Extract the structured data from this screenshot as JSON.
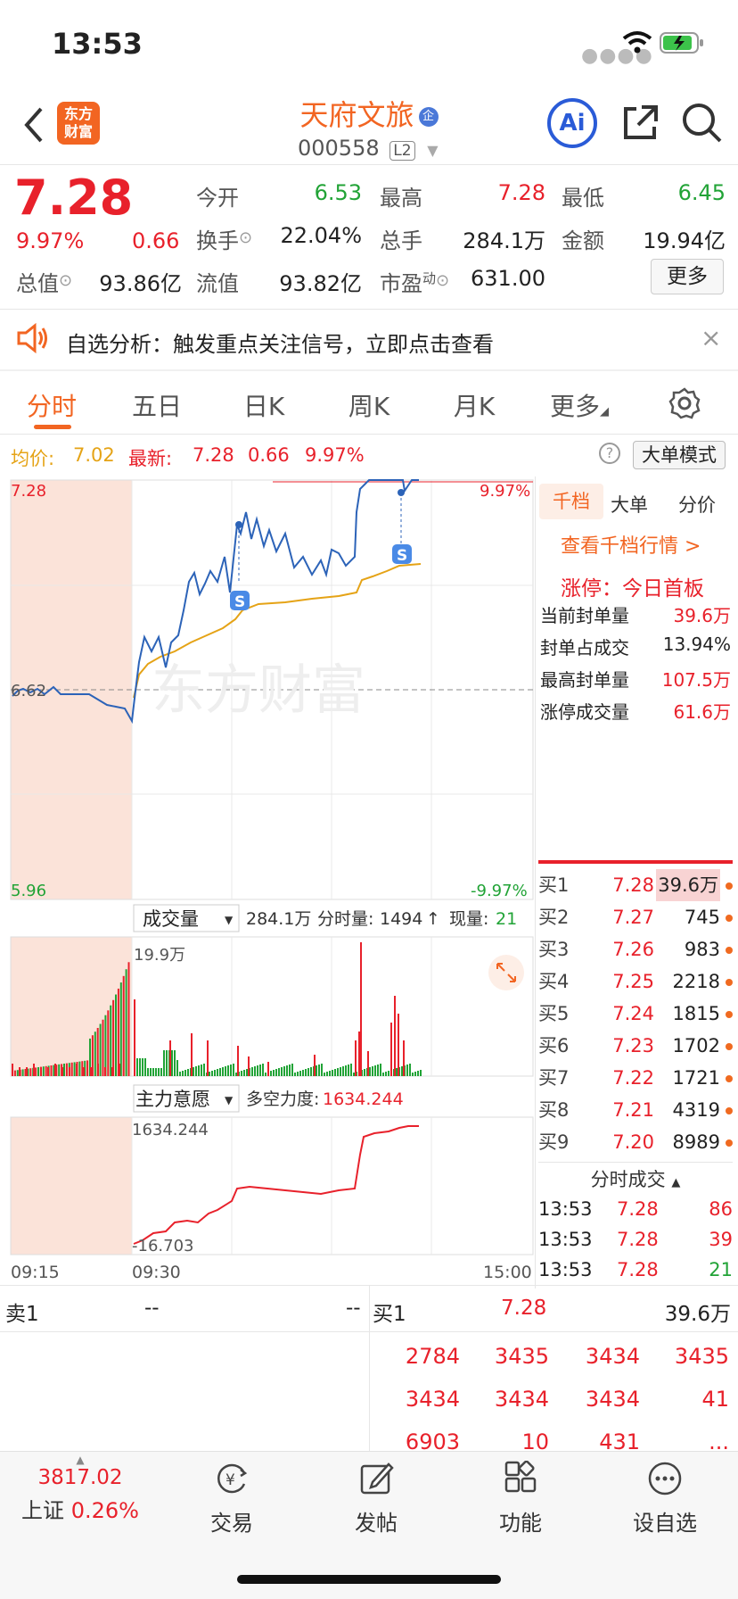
{
  "status": {
    "time": "13:53"
  },
  "header": {
    "logo_line1": "东方",
    "logo_line2": "财富",
    "title": "天府文旅",
    "badge": "企",
    "code": "000558",
    "level": "L2",
    "ai": "Ai"
  },
  "quote": {
    "price": "7.28",
    "pct": "9.97%",
    "change": "0.66",
    "open_l": "今开",
    "open_v": "6.53",
    "high_l": "最高",
    "high_v": "7.28",
    "low_l": "最低",
    "low_v": "6.45",
    "turn_l": "换手",
    "turn_v": "22.04%",
    "vol_l": "总手",
    "vol_v": "284.1万",
    "amt_l": "金额",
    "amt_v": "19.94亿",
    "mcap_l": "总值",
    "mcap_v": "93.86亿",
    "float_l": "流值",
    "float_v": "93.82亿",
    "pe_l": "市盈",
    "pe_sup": "动",
    "pe_v": "631.00",
    "more": "更多"
  },
  "banner": {
    "text": "自选分析：触发重点关注信号，立即点击查看"
  },
  "tabs": [
    "分时",
    "五日",
    "日K",
    "周K",
    "月K",
    "更多"
  ],
  "info": {
    "avg_l": "均价:",
    "avg_v": "7.02",
    "last_l": "最新:",
    "last_v": "7.28",
    "chg": "0.66",
    "pct": "9.97%",
    "mode": "大单模式"
  },
  "chart": {
    "y_top": "7.28",
    "y_mid": "6.62",
    "y_bot": "5.96",
    "pct_top": "9.97%",
    "pct_bot": "-9.97%",
    "vol_btn": "成交量",
    "vol_total": "284.1万",
    "vol_fen_l": "分时量:",
    "vol_fen_v": "1494",
    "vol_now_l": "现量:",
    "vol_now_v": "21",
    "vol_max": "19.9万",
    "ind_btn": "主力意愿",
    "ind_l": "多空力度:",
    "ind_v": "1634.244",
    "ind_top": "1634.244",
    "ind_bot": "-16.703",
    "t0": "09:15",
    "t1": "09:30",
    "t2": "15:00",
    "watermark": "东方财富",
    "s_mark": "S"
  },
  "chart_data": {
    "type": "line",
    "x": [
      "09:15",
      "09:30",
      "15:00"
    ],
    "ylim": [
      5.96,
      7.28
    ],
    "series": [
      {
        "name": "均价",
        "color": "#e5a316"
      },
      {
        "name": "最新",
        "color": "#2c63b8"
      }
    ]
  },
  "side": {
    "t1": "千档",
    "t2": "大单",
    "t3": "分价",
    "link": "查看千档行情 >",
    "limit": "涨停：今日首板",
    "r1_l": "当前封单量",
    "r1_v": "39.6万",
    "r2_l": "封单占成交",
    "r2_v": "13.94%",
    "r3_l": "最高封单量",
    "r3_v": "107.5万",
    "r4_l": "涨停成交量",
    "r4_v": "61.6万"
  },
  "book": [
    {
      "n": "买1",
      "p": "7.28",
      "v": "39.6万"
    },
    {
      "n": "买2",
      "p": "7.27",
      "v": "745"
    },
    {
      "n": "买3",
      "p": "7.26",
      "v": "983"
    },
    {
      "n": "买4",
      "p": "7.25",
      "v": "2218"
    },
    {
      "n": "买5",
      "p": "7.24",
      "v": "1815"
    },
    {
      "n": "买6",
      "p": "7.23",
      "v": "1702"
    },
    {
      "n": "买7",
      "p": "7.22",
      "v": "1721"
    },
    {
      "n": "买8",
      "p": "7.21",
      "v": "4319"
    },
    {
      "n": "买9",
      "p": "7.20",
      "v": "8989"
    }
  ],
  "ticks": {
    "title": "分时成交",
    "rows": [
      {
        "t": "13:53",
        "p": "7.28",
        "v": "86"
      },
      {
        "t": "13:53",
        "p": "7.28",
        "v": "39"
      },
      {
        "t": "13:53",
        "p": "7.28",
        "v": "21"
      }
    ]
  },
  "orderbar": {
    "sell_l": "卖1",
    "sell_p": "--",
    "sell_v": "--",
    "buy_l": "买1",
    "buy_p": "7.28",
    "buy_v": "39.6万",
    "q": [
      [
        "2784",
        "3435",
        "3434",
        "3435"
      ],
      [
        "3434",
        "3434",
        "3434",
        "41"
      ],
      [
        "6903",
        "10",
        "431",
        "..."
      ]
    ]
  },
  "bottom": {
    "index_v": "3817.02",
    "index_n": "上证",
    "index_p": "0.26%",
    "n1": "交易",
    "n2": "发帖",
    "n3": "功能",
    "n4": "设自选"
  }
}
